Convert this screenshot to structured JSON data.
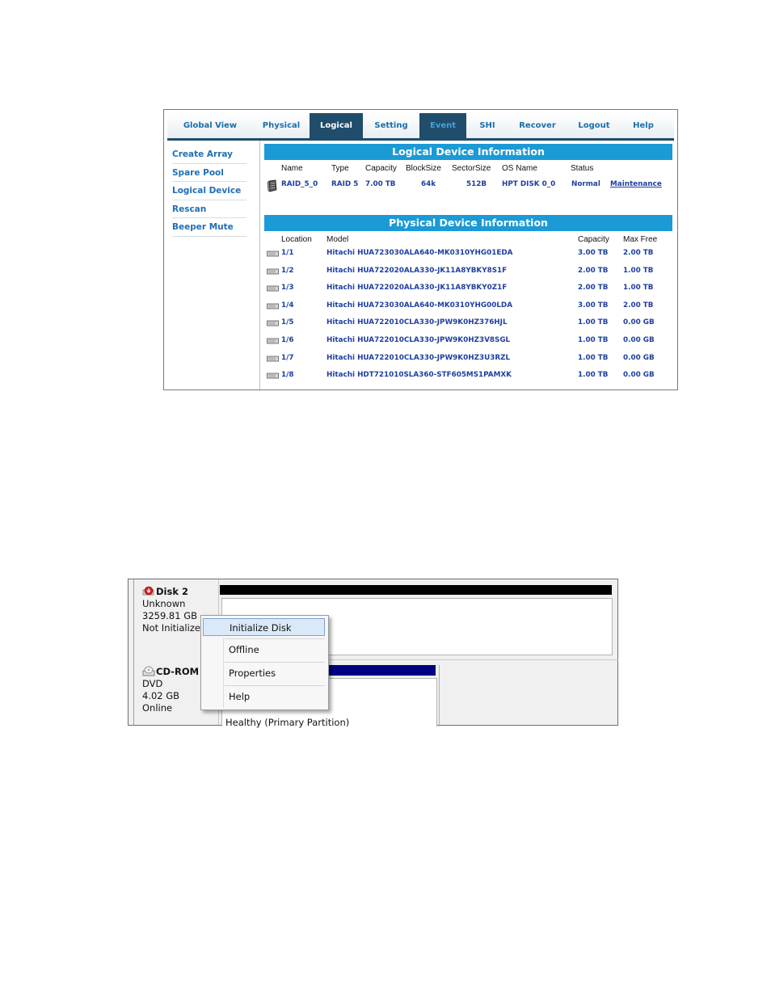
{
  "raid_ui": {
    "tabs": [
      {
        "label": "Global View"
      },
      {
        "label": "Physical"
      },
      {
        "label": "Logical"
      },
      {
        "label": "Setting"
      },
      {
        "label": "Event"
      },
      {
        "label": "SHI"
      },
      {
        "label": "Recover"
      },
      {
        "label": "Logout"
      },
      {
        "label": "Help"
      }
    ],
    "active_tab": "Logical",
    "sidebar": [
      "Create Array",
      "Spare Pool",
      "Logical Device",
      "Rescan",
      "Beeper Mute"
    ],
    "logical": {
      "title": "Logical Device Information",
      "headers": [
        "Name",
        "Type",
        "Capacity",
        "BlockSize",
        "SectorSize",
        "OS Name",
        "Status"
      ],
      "row": {
        "name": "RAID_5_0",
        "type": "RAID 5",
        "capacity": "7.00 TB",
        "blocksize": "64k",
        "sectorsize": "512B",
        "os_name": "HPT DISK 0_0",
        "status": "Normal",
        "action": "Maintenance"
      }
    },
    "physical": {
      "title": "Physical Device Information",
      "headers": [
        "Location",
        "Model",
        "Capacity",
        "Max Free"
      ],
      "rows": [
        {
          "location": "1/1",
          "model": "Hitachi HUA723030ALA640-MK0310YHG01EDA",
          "capacity": "3.00 TB",
          "max_free": "2.00 TB"
        },
        {
          "location": "1/2",
          "model": "Hitachi HUA722020ALA330-JK11A8YBKY8S1F",
          "capacity": "2.00 TB",
          "max_free": "1.00 TB"
        },
        {
          "location": "1/3",
          "model": "Hitachi HUA722020ALA330-JK11A8YBKY0Z1F",
          "capacity": "2.00 TB",
          "max_free": "1.00 TB"
        },
        {
          "location": "1/4",
          "model": "Hitachi HUA723030ALA640-MK0310YHG00LDA",
          "capacity": "3.00 TB",
          "max_free": "2.00 TB"
        },
        {
          "location": "1/5",
          "model": "Hitachi HUA722010CLA330-JPW9K0HZ376HJL",
          "capacity": "1.00 TB",
          "max_free": "0.00 GB"
        },
        {
          "location": "1/6",
          "model": "Hitachi HUA722010CLA330-JPW9K0HZ3V8SGL",
          "capacity": "1.00 TB",
          "max_free": "0.00 GB"
        },
        {
          "location": "1/7",
          "model": "Hitachi HUA722010CLA330-JPW9K0HZ3U3RZL",
          "capacity": "1.00 TB",
          "max_free": "0.00 GB"
        },
        {
          "location": "1/8",
          "model": "Hitachi HDT721010SLA360-STF605MS1PAMXK",
          "capacity": "1.00 TB",
          "max_free": "0.00 GB"
        }
      ]
    },
    "colors": {
      "accent": "#1b9ad6",
      "tab_active_bg": "#1f4d6b",
      "link": "#1f6fb5"
    }
  },
  "disk_mgmt": {
    "disk2": {
      "title": "Disk 2",
      "type": "Unknown",
      "size": "3259.81 GB",
      "state": "Not Initialized"
    },
    "cdrom": {
      "title": "CD-ROM 0",
      "type": "DVD",
      "size": "4.02 GB",
      "state": "Online"
    },
    "volume_status": "Healthy (Primary Partition)",
    "context_menu": [
      "Initialize Disk",
      "Offline",
      "Properties",
      "Help"
    ],
    "highlighted_item": "Initialize Disk"
  }
}
